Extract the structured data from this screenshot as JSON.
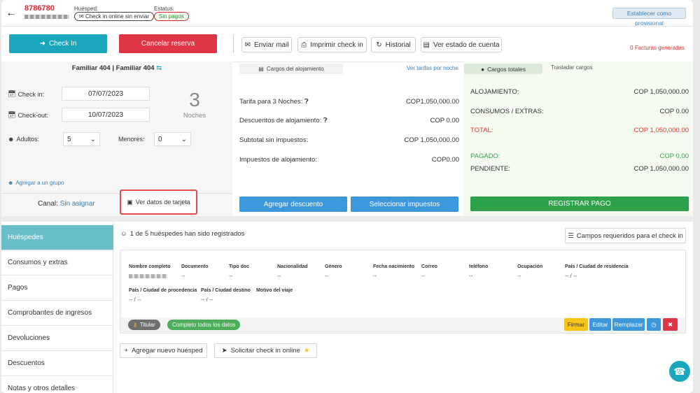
{
  "header": {
    "reservation_id": "8786780",
    "guest_label": "Huésped:",
    "guest_status": "Check in online sin enviar",
    "status_label": "Estatus:",
    "status_value": "Sin pagos",
    "provisional_button": "Establecer como provisional"
  },
  "actions": {
    "checkin": "Check In",
    "cancel": "Cancelar reserva",
    "send_mail": "Enviar mail",
    "print_checkin": "Imprimir check in",
    "history": "Historial",
    "account_state": "Ver estado de cuenta",
    "invoices": "0 Facturas generadas"
  },
  "booking": {
    "room": "Familiar 404 | Familiar 404",
    "checkin_label": "Check in:",
    "checkin_value": "07/07/2023",
    "checkout_label": "Check-out:",
    "checkout_value": "10/07/2023",
    "nights_value": "3",
    "nights_label": "Noches",
    "adults_label": "Adultos:",
    "adults_value": "5",
    "minors_label": "Menores:",
    "minors_value": "0",
    "group_link": "Agregar a un grupo",
    "channel_label": "Canal:",
    "channel_value": "Sin asignar",
    "card_button": "Ver datos de tarjeta"
  },
  "charges": {
    "tab": "Cargos del alojamiento",
    "tariffs_link": "Ver tarifas por noche",
    "rows": [
      {
        "label": "Tarifa para 3 Noches:",
        "value": "COP1,050,000.00"
      },
      {
        "label": "Descuentos de alojamiento:",
        "value": "COP 0.00"
      },
      {
        "label": "Subtotal sin impuestos:",
        "value": "COP 1,050,000.00"
      },
      {
        "label": "Impuestos de alojamiento:",
        "value": "COP0.00"
      }
    ],
    "add_discount": "Agregar descuento",
    "select_taxes": "Seleccionar impuestos"
  },
  "totals": {
    "tab": "Cargos totales",
    "move_tab": "Trasladar cargos",
    "lodging_label": "ALOJAMIENTO:",
    "lodging_value": "COP 1,050,000.00",
    "consumos_label": "CONSUMOS / EXTRAS:",
    "consumos_value": "COP 0.00",
    "total_label": "TOTAL:",
    "total_value": "COP 1,050,000.00",
    "paid_label": "PAGADO:",
    "paid_value": "COP 0.00",
    "pending_label": "PENDIENTE:",
    "pending_value": "COP 1,050,000.00",
    "register_payment": "REGISTRAR PAGO"
  },
  "sidebar": {
    "items": [
      {
        "label": "Huéspedes"
      },
      {
        "label": "Consumos y extras"
      },
      {
        "label": "Pagos"
      },
      {
        "label": "Comprobantes de ingresos"
      },
      {
        "label": "Devoluciones"
      },
      {
        "label": "Descuentos"
      },
      {
        "label": "Notas y otros detalles"
      }
    ]
  },
  "guests": {
    "title": "1 de 5 huéspedes han sido registrados",
    "required_fields": "Campos requeridos para el check in",
    "row1": [
      {
        "h": "Nombre completo",
        "v": ""
      },
      {
        "h": "Documento",
        "v": "--"
      },
      {
        "h": "Tipo doc",
        "v": "--"
      },
      {
        "h": "Nacionalidad",
        "v": "--"
      },
      {
        "h": "Género",
        "v": "--"
      },
      {
        "h": "Fecha nacimiento",
        "v": "--"
      },
      {
        "h": "Correo",
        "v": "--"
      },
      {
        "h": "teléfono",
        "v": "--"
      },
      {
        "h": "Ocupación",
        "v": "--"
      },
      {
        "h": "País / Ciudad de residencia",
        "v": "-- / --"
      }
    ],
    "row2": [
      {
        "h": "País / Ciudad de procedencia",
        "v": "-- / --"
      },
      {
        "h": "País / Ciudad destino",
        "v": "-- / --"
      },
      {
        "h": "Motivo del viaje",
        "v": ""
      }
    ],
    "holder_badge": "Titular",
    "complete_badge": "Completo todos los datos",
    "sign": "Firmar",
    "edit": "Editar",
    "replace": "Remplazar",
    "add_guest": "Agregar nuevo huésped",
    "request_online": "Solicitar check in online"
  },
  "colors": {
    "teal": "#1aa7bd",
    "red": "#e03545",
    "blue": "#3c97dc",
    "green": "#2ea24a",
    "yellow": "#f5c518"
  }
}
